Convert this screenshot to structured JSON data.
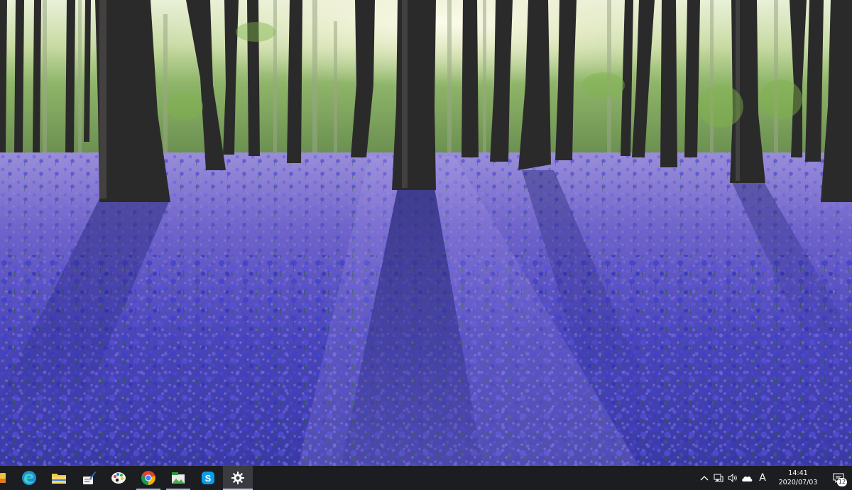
{
  "taskbar": {
    "apps": [
      {
        "name": "start-partial",
        "icon": "app-partial-icon"
      },
      {
        "name": "edge",
        "icon": "edge-icon"
      },
      {
        "name": "file-explorer",
        "icon": "folder-icon"
      },
      {
        "name": "paint-app",
        "icon": "paintbrush-icon"
      },
      {
        "name": "palette-app",
        "icon": "palette-icon"
      },
      {
        "name": "chrome",
        "icon": "chrome-icon"
      },
      {
        "name": "screenshot-app",
        "icon": "image-app-icon"
      },
      {
        "name": "skype",
        "icon": "skype-icon"
      },
      {
        "name": "settings",
        "icon": "gear-icon"
      }
    ],
    "colors": {
      "background": "#1c1d21",
      "active_tile": "#3a3b40",
      "running_indicator": "#a6b8d4"
    }
  },
  "tray": {
    "chevron": "^",
    "ime_label": "A",
    "icons": [
      "chevron-up-icon",
      "network-icon",
      "volume-icon",
      "onedrive-icon",
      "ime-icon"
    ]
  },
  "clock": {
    "time": "14:41",
    "date": "2020/07/03"
  },
  "notifications": {
    "count": "12"
  },
  "wallpaper": {
    "subject": "bluebell-forest-wallpaper"
  }
}
